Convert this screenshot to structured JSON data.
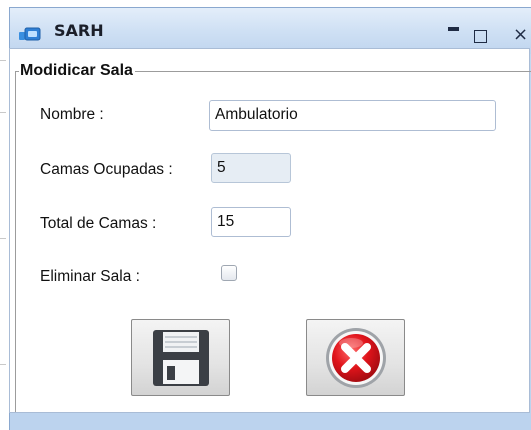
{
  "window": {
    "title": "SARH",
    "controls": {
      "minimize": "minimize",
      "maximize": "maximize",
      "close": "×"
    }
  },
  "form": {
    "group_title": "Modidicar Sala",
    "nombre": {
      "label": "Nombre :",
      "value": "Ambulatorio"
    },
    "camas_ocupadas": {
      "label": "Camas Ocupadas :",
      "value": "5"
    },
    "total_camas": {
      "label": "Total de Camas :",
      "value": "15"
    },
    "eliminar_sala": {
      "label": "Eliminar Sala :",
      "checked": false
    }
  },
  "buttons": {
    "save": {
      "icon": "floppy-disk-icon"
    },
    "cancel": {
      "icon": "red-cancel-x-icon"
    }
  },
  "colors": {
    "title_bar": "#c9dcf2",
    "cancel_red": "#d8191f",
    "floppy_dark": "#3b3f45"
  }
}
